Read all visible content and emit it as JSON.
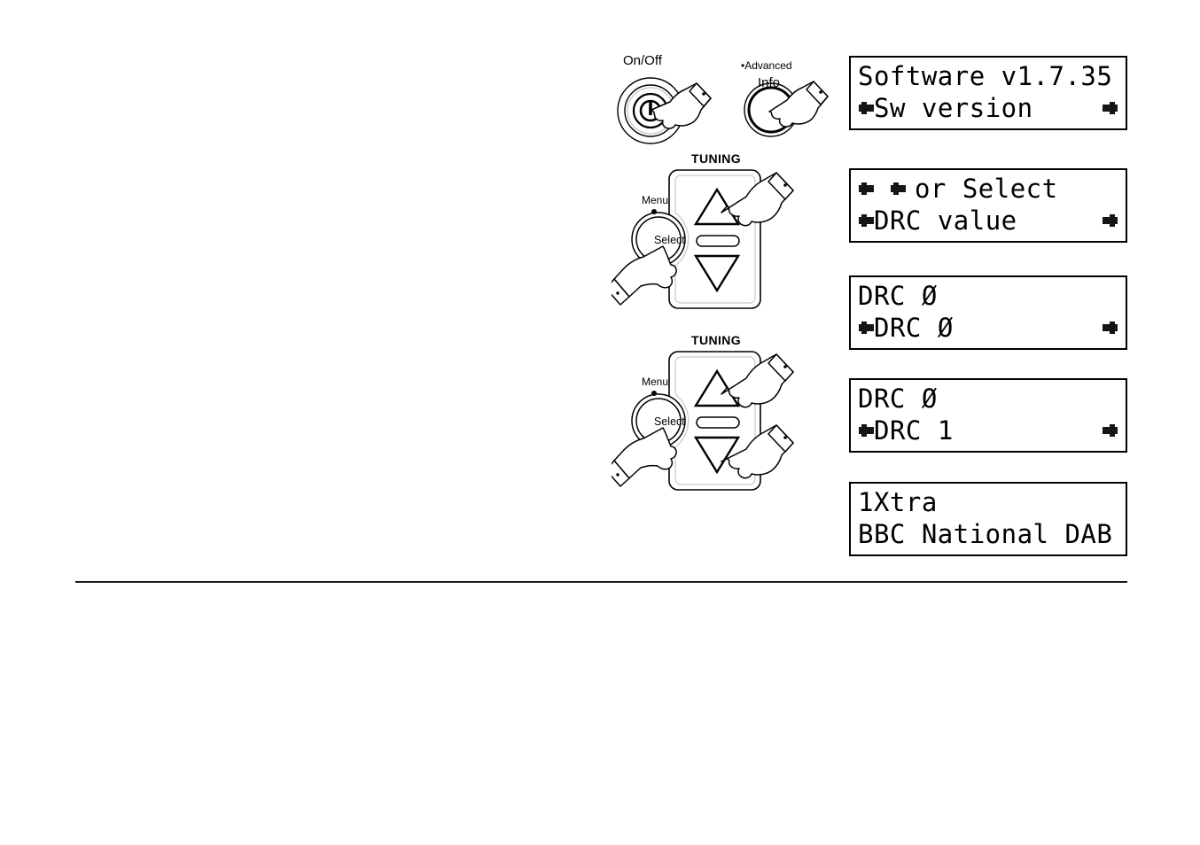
{
  "page": {
    "background": "#ffffff",
    "ink": "#000000"
  },
  "controls": {
    "power": {
      "label": "On/Off",
      "icon": "power-symbol",
      "hand": "pointing-hand-icon"
    },
    "info": {
      "label_top": "Advanced",
      "bullet": "•",
      "label_bottom": "Info",
      "hand": "pointing-hand-icon"
    },
    "tuning_groups": [
      {
        "heading": "TUNING",
        "menu_label": "Menu",
        "menu_dot": "•",
        "select_label": "Select",
        "up_arrow": "tuning-up-arrow",
        "down_arrow": "tuning-down-arrow",
        "hands": [
          "select-hand",
          "up-arrow-hand"
        ]
      },
      {
        "heading": "TUNING",
        "menu_label": "Menu",
        "menu_dot": "•",
        "select_label": "Select",
        "up_arrow": "tuning-up-arrow",
        "down_arrow": "tuning-down-arrow",
        "hands": [
          "select-hand",
          "up-arrow-hand",
          "down-arrow-hand"
        ]
      }
    ]
  },
  "displays": [
    {
      "name": "sw-version-display",
      "line1": "Software v1.7.35",
      "line2": "Sw version",
      "line1_left_arrow": false,
      "line1_right_arrow": false,
      "line2_left_arrow": true,
      "line2_right_arrow": true
    },
    {
      "name": "drc-value-menu-display",
      "line1": "or Select",
      "line2": "DRC value",
      "line1_prefix_arrows": 2,
      "line1_left_arrow": false,
      "line1_right_arrow": false,
      "line2_left_arrow": true,
      "line2_right_arrow": true
    },
    {
      "name": "drc-zero-display",
      "line1": "DRC Ø",
      "line2": "DRC Ø",
      "line1_left_arrow": false,
      "line1_right_arrow": false,
      "line2_left_arrow": true,
      "line2_right_arrow": true
    },
    {
      "name": "drc-one-display",
      "line1": "DRC Ø",
      "line2": "DRC 1",
      "line1_left_arrow": false,
      "line1_right_arrow": false,
      "line2_left_arrow": true,
      "line2_right_arrow": true
    },
    {
      "name": "station-display",
      "line1": "1Xtra",
      "line2": "BBC National DAB",
      "line1_left_arrow": false,
      "line1_right_arrow": false,
      "line2_left_arrow": false,
      "line2_right_arrow": false
    }
  ]
}
